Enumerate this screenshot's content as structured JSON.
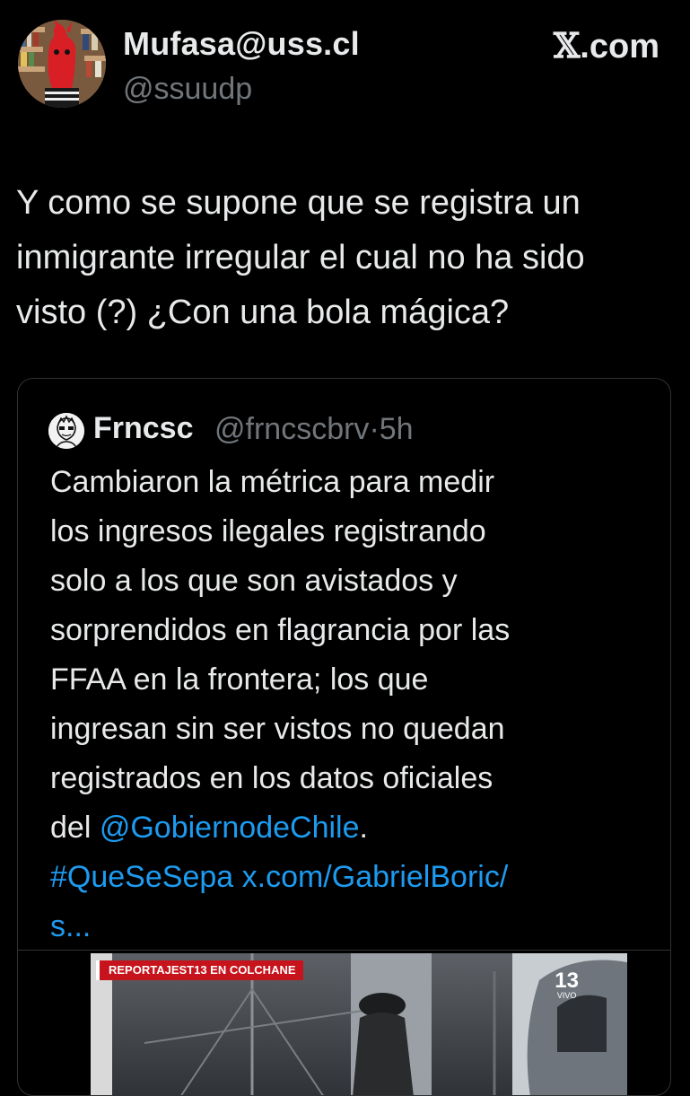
{
  "author": {
    "display_name": "Mufasa@uss.cl",
    "handle": "@ssuudp",
    "avatar_icon": "profile-avatar"
  },
  "brand": {
    "label": "X.com",
    "icon": "x-logo-icon"
  },
  "tweet": {
    "text_lines": [
      "Y como se supone que se registra un",
      "inmigrante irregular el cual no ha sido",
      "visto (?) ¿Con una bola mágica?"
    ]
  },
  "quote": {
    "name": "Frncsc",
    "handle": "@frncscbrv",
    "separator": "·",
    "time": "5h",
    "text_lines": [
      "Cambiaron la métrica para medir",
      "los ingresos ilegales registrando",
      "solo a los que son avistados y",
      "sorprendidos en flagrancia por las",
      "FFAA en la frontera; los que",
      "ingresan sin ser vistos no quedan",
      "registrados en los datos oficiales"
    ],
    "mention_prefix": "del ",
    "mention": "@GobiernodeChile",
    "mention_suffix": ".",
    "hashtag": "#QueSeSepa",
    "url": "x.com/GabrielBoric/",
    "url_continuation": "s..."
  },
  "media": {
    "lower_third": "REPORTAJEST13 EN COLCHANE",
    "channel_logo": "13",
    "channel_live": "VIVO"
  },
  "colors": {
    "background": "#000000",
    "text_primary": "#e7e9ea",
    "text_secondary": "#71767b",
    "link": "#1d9bf0",
    "border": "#2f3336",
    "lower_third_red": "#c7131b"
  }
}
